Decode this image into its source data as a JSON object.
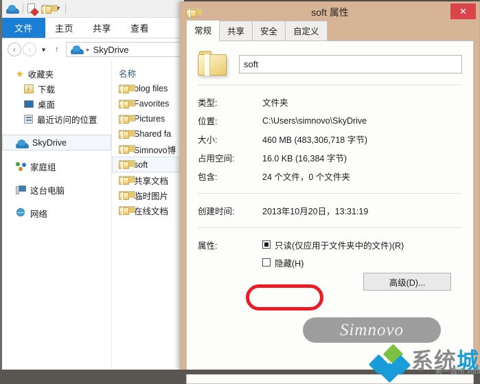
{
  "explorer": {
    "quick_access_toolbar": {
      "items": [
        {
          "name": "skydrive-cloud-icon",
          "label": ""
        },
        {
          "name": "properties-icon",
          "label": ""
        },
        {
          "name": "new-folder-icon",
          "label": ""
        },
        {
          "name": "customize-dropdown-icon",
          "label": "▼"
        }
      ]
    },
    "ribbon_tabs": [
      {
        "label": "文件",
        "active": true
      },
      {
        "label": "主页",
        "active": false
      },
      {
        "label": "共享",
        "active": false
      },
      {
        "label": "查看",
        "active": false
      }
    ],
    "nav": {
      "back": "‹",
      "forward": "›",
      "recent_dropdown": "▾",
      "up": "↑",
      "address_value": "SkyDrive",
      "address_separator": "▸"
    },
    "nav_pane": [
      {
        "label": "收藏夹",
        "icon": "star-icon",
        "level": 0
      },
      {
        "label": "下载",
        "icon": "downloads-folder-icon",
        "level": 1
      },
      {
        "label": "桌面",
        "icon": "desktop-icon",
        "level": 1
      },
      {
        "label": "最近访问的位置",
        "icon": "recent-places-icon",
        "level": 1
      },
      {
        "label": "SkyDrive",
        "icon": "skydrive-cloud-icon",
        "level": 0,
        "selected": true
      },
      {
        "label": "家庭组",
        "icon": "homegroup-icon",
        "level": 0
      },
      {
        "label": "这台电脑",
        "icon": "this-pc-icon",
        "level": 0
      },
      {
        "label": "网络",
        "icon": "network-icon",
        "level": 0
      }
    ],
    "file_list": {
      "column_header": "名称",
      "rows": [
        {
          "label": "blog files",
          "selected": false
        },
        {
          "label": "Favorites",
          "selected": false
        },
        {
          "label": "Pictures",
          "selected": false
        },
        {
          "label": "Shared fa",
          "selected": false
        },
        {
          "label": "Simnovo博",
          "selected": false
        },
        {
          "label": "soft",
          "selected": true
        },
        {
          "label": "共享文档",
          "selected": false
        },
        {
          "label": "临时图片",
          "selected": false
        },
        {
          "label": "在线文档",
          "selected": false
        }
      ]
    }
  },
  "dialog": {
    "title": "soft 属性",
    "close_label": "✕",
    "tabs": [
      {
        "label": "常规",
        "active": true
      },
      {
        "label": "共享",
        "active": false
      },
      {
        "label": "安全",
        "active": false
      },
      {
        "label": "自定义",
        "active": false
      }
    ],
    "name_value": "soft",
    "properties": [
      {
        "label": "类型:",
        "value": "文件夹"
      },
      {
        "label": "位置:",
        "value": "C:\\Users\\simnovo\\SkyDrive"
      },
      {
        "label": "大小:",
        "value": "460 MB (483,306,718 字节)"
      },
      {
        "label": "占用空间:",
        "value": "16.0 KB (16,384 字节)"
      },
      {
        "label": "包含:",
        "value": "24 个文件，0 个文件夹"
      }
    ],
    "created": {
      "label": "创建时间:",
      "value": "2013年10月20日，13:31:19"
    },
    "attributes": {
      "label": "属性:",
      "readonly": {
        "label": "只读(仅应用于文件夹中的文件)(R)",
        "state": "partial"
      },
      "hidden": {
        "label": "隐藏(H)",
        "state": "unchecked"
      },
      "advanced_button": "高级(D)..."
    },
    "accent_titlebar_color": "#d7b496",
    "close_button_color": "#d9454a"
  },
  "watermarks": {
    "badge_text": "Simnovo",
    "logo_text_gray": "系统",
    "logo_text_blue": "城",
    "logo_subtitle": "第一城市 xitongcheng.com"
  }
}
